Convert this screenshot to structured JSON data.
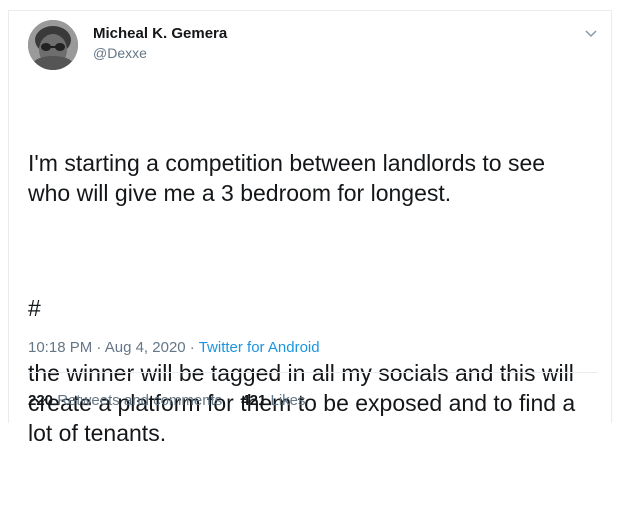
{
  "author": {
    "name": "Micheal K. Gemera",
    "handle": "@Dexxe"
  },
  "tweet": {
    "paragraph1": "I'm starting a competition between landlords to see\nwho will give me a 3 bedroom for longest.",
    "paragraph2": "the winner will be tagged in all my socials and this will\ncreate a platform for them to be exposed and to find a\nlot of tenants.",
    "hashtag": "#"
  },
  "meta": {
    "time": "10:18 PM",
    "separator1": " · ",
    "date": "Aug 4, 2020",
    "separator2": " · ",
    "source": "Twitter for Android"
  },
  "stats": {
    "retweets_count": "220",
    "retweets_label": "Retweets and comments",
    "likes_count": "421",
    "likes_label": "Likes"
  },
  "colors": {
    "accent": "#1b95e0",
    "secondary_text": "#657786",
    "border": "#e6ecf0"
  },
  "icons": {
    "caret": "chevron-down-icon"
  }
}
